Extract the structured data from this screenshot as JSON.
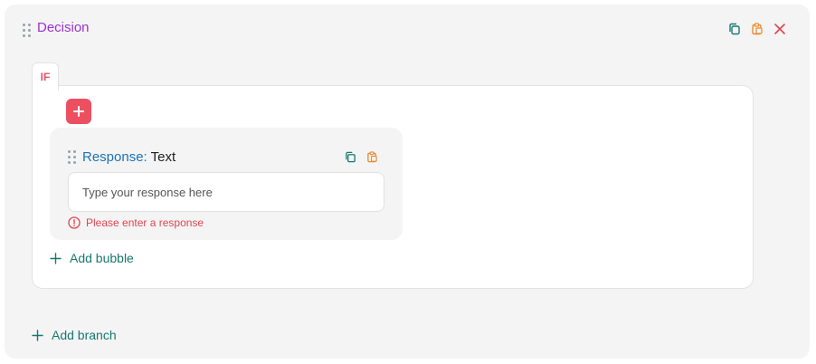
{
  "decision": {
    "title": "Decision"
  },
  "header_actions": {
    "copy_icon": "copy-icon",
    "paste_icon": "paste-icon",
    "close_icon": "close-icon"
  },
  "branch": {
    "tab_label": "IF"
  },
  "response": {
    "label": "Response:",
    "type": "Text",
    "placeholder": "Type your response here",
    "value": "",
    "error": "Please enter a response"
  },
  "actions": {
    "add_bubble": "Add bubble",
    "add_branch": "Add branch"
  },
  "colors": {
    "decision_title": "#9b32d3",
    "response_label": "#1b73b3",
    "teal": "#16796f",
    "orange": "#e88a2f",
    "red": "#ec5060",
    "card_bg": "#f4f4f4"
  }
}
